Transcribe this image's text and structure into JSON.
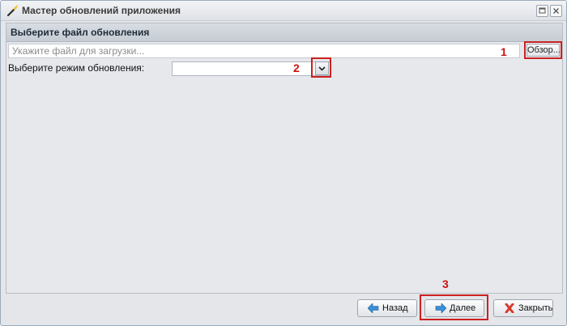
{
  "window": {
    "title": "Мастер обновлений приложения"
  },
  "panel": {
    "title": "Выберите файл обновления",
    "file_input": {
      "placeholder": "Укажите файл для загрузки...",
      "value": ""
    },
    "browse_label": "Обзор...",
    "mode_label": "Выберите режим обновления:",
    "mode_select": {
      "value": ""
    }
  },
  "callouts": [
    "1",
    "2",
    "3"
  ],
  "footer": {
    "back_label": "Назад",
    "next_label": "Далее",
    "close_label": "Закрыть"
  },
  "colors": {
    "callout_red": "#cc2020",
    "accent_blue": "#3a8fd6",
    "close_red": "#d83a2c"
  },
  "icons": {
    "title": "magic-wand-icon",
    "back": "arrow-left-icon",
    "next": "arrow-right-icon",
    "close": "cross-icon"
  }
}
